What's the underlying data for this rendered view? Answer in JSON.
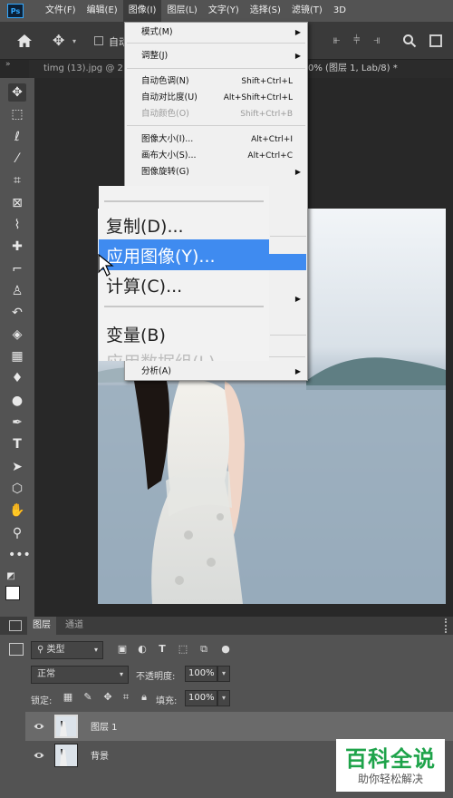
{
  "menubar": {
    "items": [
      "文件(F)",
      "编辑(E)",
      "图像(I)",
      "图层(L)",
      "文字(Y)",
      "选择(S)",
      "滤镜(T)",
      "3D"
    ]
  },
  "options_bar": {
    "auto_select_label": "自动"
  },
  "doc_tabs": [
    "timg (13).jpg @ 2",
    "0% (图层 1, Lab/8) *"
  ],
  "image_menu": {
    "items": [
      {
        "label": "模式(M)",
        "submenu": true
      },
      {
        "label": "调整(J)",
        "submenu": true
      },
      {
        "label": "自动色调(N)",
        "shortcut": "Shift+Ctrl+L"
      },
      {
        "label": "自动对比度(U)",
        "shortcut": "Alt+Shift+Ctrl+L"
      },
      {
        "label": "自动颜色(O)",
        "shortcut": "Shift+Ctrl+B",
        "disabled": true
      },
      {
        "label": "图像大小(I)...",
        "shortcut": "Alt+Ctrl+I"
      },
      {
        "label": "画布大小(S)...",
        "shortcut": "Alt+Ctrl+C"
      },
      {
        "label": "图像旋转(G)",
        "submenu": true
      },
      {
        "label": "分析(A)",
        "submenu": true
      }
    ]
  },
  "zoom_overlay": {
    "items": [
      "复制(D)...",
      "应用图像(Y)...",
      "计算(C)...",
      "变量(B)",
      "应用数据组(L)..."
    ]
  },
  "layers_panel": {
    "tabs": [
      "图层",
      "通道"
    ],
    "filter_label": "类型",
    "blend_mode": "正常",
    "opacity_label": "不透明度:",
    "opacity_value": "100%",
    "lock_label": "锁定:",
    "fill_label": "填充:",
    "fill_value": "100%",
    "layers": [
      {
        "name": "图层 1",
        "selected": true
      },
      {
        "name": "背景",
        "selected": false
      }
    ]
  },
  "watermark": {
    "title": "百科全说",
    "subtitle": "助你轻松解决"
  },
  "colors": {
    "accent": "#3f8bf0",
    "watermark_green": "#1ea34a"
  }
}
